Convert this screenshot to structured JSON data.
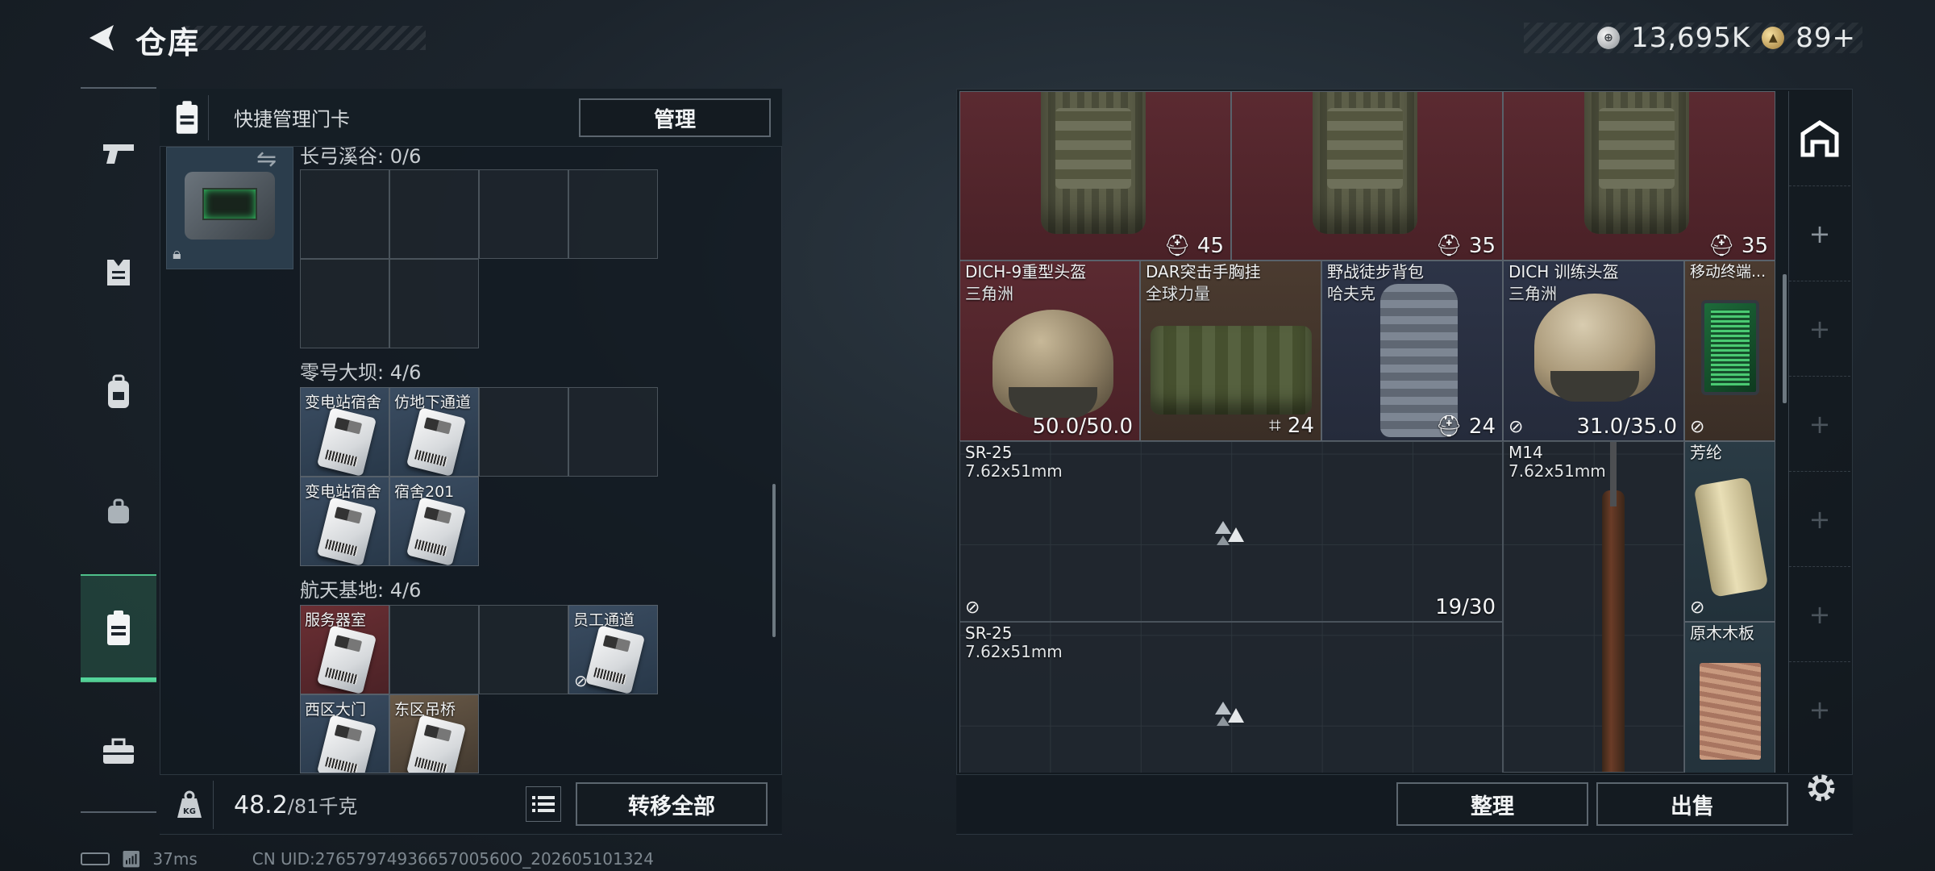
{
  "header": {
    "title": "仓库",
    "currency_silver": "13,695K",
    "currency_gold": "89+"
  },
  "left_nav": {
    "items": [
      "weapons-icon",
      "armor-icon",
      "backpack-icon",
      "rig-icon",
      "keycard-icon",
      "toolbox-icon"
    ],
    "active": "keycard-icon"
  },
  "keycard_panel": {
    "title": "快捷管理门卡",
    "manage_label": "管理",
    "sections": [
      {
        "label": "长弓溪谷: 0/6",
        "cards": []
      },
      {
        "label": "零号大坝: 4/6",
        "cards": [
          "变电站宿舍",
          "仿地下通道",
          "变电站宿舍",
          "宿舍201"
        ]
      },
      {
        "label": "航天基地: 4/6",
        "cards": [
          "服务器室",
          "员工通道",
          "西区大门",
          "东区吊桥"
        ]
      }
    ],
    "weight_value": "48.2",
    "weight_max": "/81千克",
    "transfer_all_label": "转移全部"
  },
  "stash": {
    "items": [
      {
        "name": "",
        "value": "45",
        "color": "red"
      },
      {
        "name": "",
        "value": "35",
        "color": "red"
      },
      {
        "name": "",
        "value": "35",
        "color": "red"
      },
      {
        "name": "DICH-9重型头盔",
        "sub": "三角洲",
        "value": "50.0/50.0",
        "color": "red"
      },
      {
        "name": "DAR突击手胸挂",
        "sub": "全球力量",
        "value": "24",
        "color": "brown"
      },
      {
        "name": "野战徒步背包",
        "sub": "哈夫克",
        "value": "24",
        "color": "navy"
      },
      {
        "name": "DICH 训练头盔",
        "sub": "三角洲",
        "value": "31.0/35.0",
        "color": "navy"
      },
      {
        "name": "移动终端...",
        "sub": "",
        "value": "",
        "color": "brown"
      },
      {
        "name": "SR-25",
        "sub": "7.62x51mm",
        "value": "19/30",
        "color": "dark"
      },
      {
        "name": "M14",
        "sub": "7.62x51mm",
        "value": "",
        "color": "dark"
      },
      {
        "name": "芳纶",
        "sub": "",
        "value": "",
        "color": "teal"
      },
      {
        "name": "SR-25",
        "sub": "7.62x51mm",
        "value": "",
        "color": "dark"
      },
      {
        "name": "原木木板",
        "sub": "",
        "value": "",
        "color": "teal"
      }
    ],
    "sort_label": "整理",
    "sell_label": "出售"
  },
  "status": {
    "ping": "37ms",
    "uid": "CN UID:2765797493665700560O_202605101324"
  }
}
